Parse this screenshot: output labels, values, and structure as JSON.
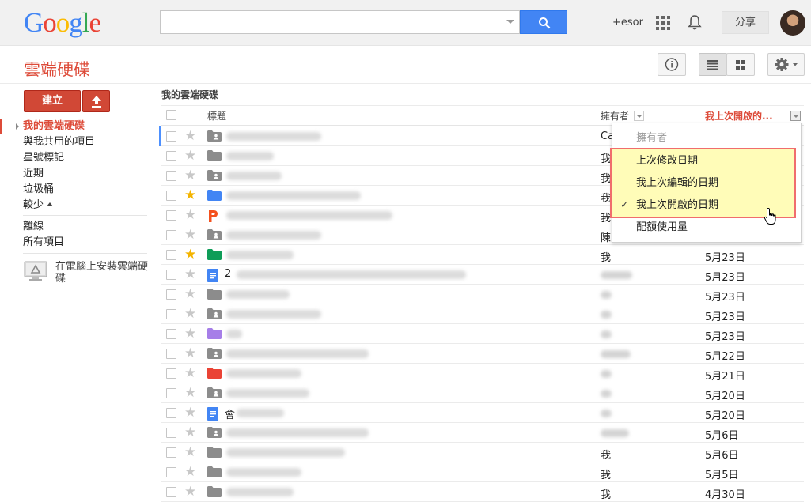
{
  "header": {
    "logo": [
      "G",
      "o",
      "o",
      "g",
      "l",
      "e"
    ],
    "logo_colors": [
      "#4285f4",
      "#ea4335",
      "#fbbc05",
      "#4285f4",
      "#34a853",
      "#ea4335"
    ],
    "search_value": "",
    "plus_user": "+esor",
    "share_label": "分享"
  },
  "app": {
    "title": "雲端硬碟"
  },
  "sidebar": {
    "create_label": "建立",
    "items": [
      {
        "label": "我的雲端硬碟",
        "active": true
      },
      {
        "label": "與我共用的項目"
      },
      {
        "label": "星號標記"
      },
      {
        "label": "近期"
      },
      {
        "label": "垃圾桶"
      },
      {
        "label": "較少"
      },
      {
        "label": "離線"
      },
      {
        "label": "所有項目"
      }
    ],
    "install_label": "在電腦上安裝雲端硬碟"
  },
  "content": {
    "breadcrumb": "我的雲端硬碟",
    "columns": {
      "title": "標題",
      "owner": "擁有者",
      "last_opened": "我上次開啟的..."
    },
    "rows": [
      {
        "icon": "shared-folder-icon",
        "color": "#8c8c8c",
        "star": false,
        "owner": "Ca",
        "date": ""
      },
      {
        "icon": "folder-icon",
        "color": "#8c8c8c",
        "star": false,
        "owner": "我",
        "date": ""
      },
      {
        "icon": "shared-folder-icon",
        "color": "#8c8c8c",
        "star": false,
        "owner": "我",
        "date": ""
      },
      {
        "icon": "folder-icon",
        "color": "#4285f4",
        "star": true,
        "owner": "我",
        "date": ""
      },
      {
        "icon": "presentation-icon",
        "color": "#f4511e",
        "star": false,
        "owner": "我",
        "date": ""
      },
      {
        "icon": "shared-folder-icon",
        "color": "#8c8c8c",
        "star": false,
        "owner": "陳",
        "date": ""
      },
      {
        "icon": "folder-icon",
        "color": "#0f9d58",
        "star": true,
        "owner": "我",
        "date": "5月23日"
      },
      {
        "icon": "document-icon",
        "color": "#4285f4",
        "star": false,
        "prefix": "2",
        "owner": "",
        "date": "5月23日"
      },
      {
        "icon": "folder-icon",
        "color": "#8c8c8c",
        "star": false,
        "owner": "",
        "date": "5月23日"
      },
      {
        "icon": "shared-folder-icon",
        "color": "#8c8c8c",
        "star": false,
        "owner": "",
        "date": "5月23日"
      },
      {
        "icon": "folder-icon",
        "color": "#a67ee8",
        "star": false,
        "owner": "",
        "date": "5月23日"
      },
      {
        "icon": "shared-folder-icon",
        "color": "#8c8c8c",
        "star": false,
        "owner": "",
        "date": "5月22日"
      },
      {
        "icon": "folder-icon",
        "color": "#ea4335",
        "star": false,
        "owner": "",
        "date": "5月21日"
      },
      {
        "icon": "shared-folder-icon",
        "color": "#8c8c8c",
        "star": false,
        "owner": "",
        "date": "5月20日"
      },
      {
        "icon": "document-icon",
        "color": "#4285f4",
        "star": false,
        "prefix": "會",
        "owner": "",
        "date": "5月20日"
      },
      {
        "icon": "shared-folder-icon",
        "color": "#8c8c8c",
        "star": false,
        "owner": "",
        "date": "5月6日"
      },
      {
        "icon": "folder-icon",
        "color": "#8c8c8c",
        "star": false,
        "owner": "我",
        "date": "5月6日"
      },
      {
        "icon": "folder-icon",
        "color": "#8c8c8c",
        "star": false,
        "owner": "我",
        "date": "5月5日"
      },
      {
        "icon": "folder-icon",
        "color": "#8c8c8c",
        "star": false,
        "owner": "我",
        "date": "4月30日"
      }
    ]
  },
  "sort_menu": {
    "items": [
      {
        "label": "擁有者",
        "disabled": true
      },
      {
        "label": "上次修改日期"
      },
      {
        "label": "我上次編輯的日期"
      },
      {
        "label": "我上次開啟的日期",
        "checked": true
      },
      {
        "label": "配額使用量"
      }
    ],
    "check_mark": "✓"
  },
  "colors": {
    "accent": "#dd4b39",
    "search_blue": "#4285f4",
    "highlight": "#fffcb8",
    "highlight_border": "#f06d6d"
  }
}
